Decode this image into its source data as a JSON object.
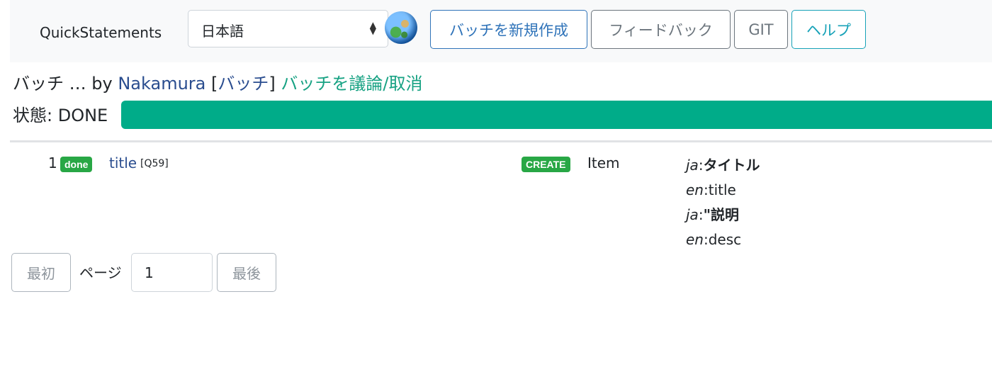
{
  "navbar": {
    "brand": "QuickStatements",
    "language_select": {
      "value": "日本語",
      "options": [
        "日本語"
      ]
    },
    "globe_icon": "globe-icon",
    "buttons": {
      "new_batch": "バッチを新規作成",
      "feedback": "フィードバック",
      "git": "GIT",
      "help": "ヘルプ"
    }
  },
  "batch": {
    "prefix": "バッチ … by",
    "user": "Nakamura",
    "bracket_open": "[",
    "batch_link": "バッチ",
    "bracket_close": "]",
    "discuss_link": "バッチを議論/取消",
    "status_label": "状態: DONE",
    "progress": 1.0
  },
  "commands": [
    {
      "number": "1",
      "status_badge": "done",
      "title": "title",
      "qid": "[Q59]",
      "action_badge": "CREATE",
      "item_type": "Item",
      "labels": [
        {
          "lang": "ja",
          "value": "タイトル"
        },
        {
          "lang": "en",
          "value": "title"
        },
        {
          "lang": "ja",
          "value": "\"説明"
        },
        {
          "lang": "en",
          "value": "desc"
        }
      ]
    }
  ],
  "pagination": {
    "first": "最初",
    "page_label": "ページ",
    "page_value": "1",
    "last": "最後"
  },
  "colors": {
    "primary": "#2f73b9",
    "info": "#17a2b8",
    "success_badge": "#28a745",
    "progress_bar": "#00ac89",
    "link_teal": "#17a283"
  }
}
